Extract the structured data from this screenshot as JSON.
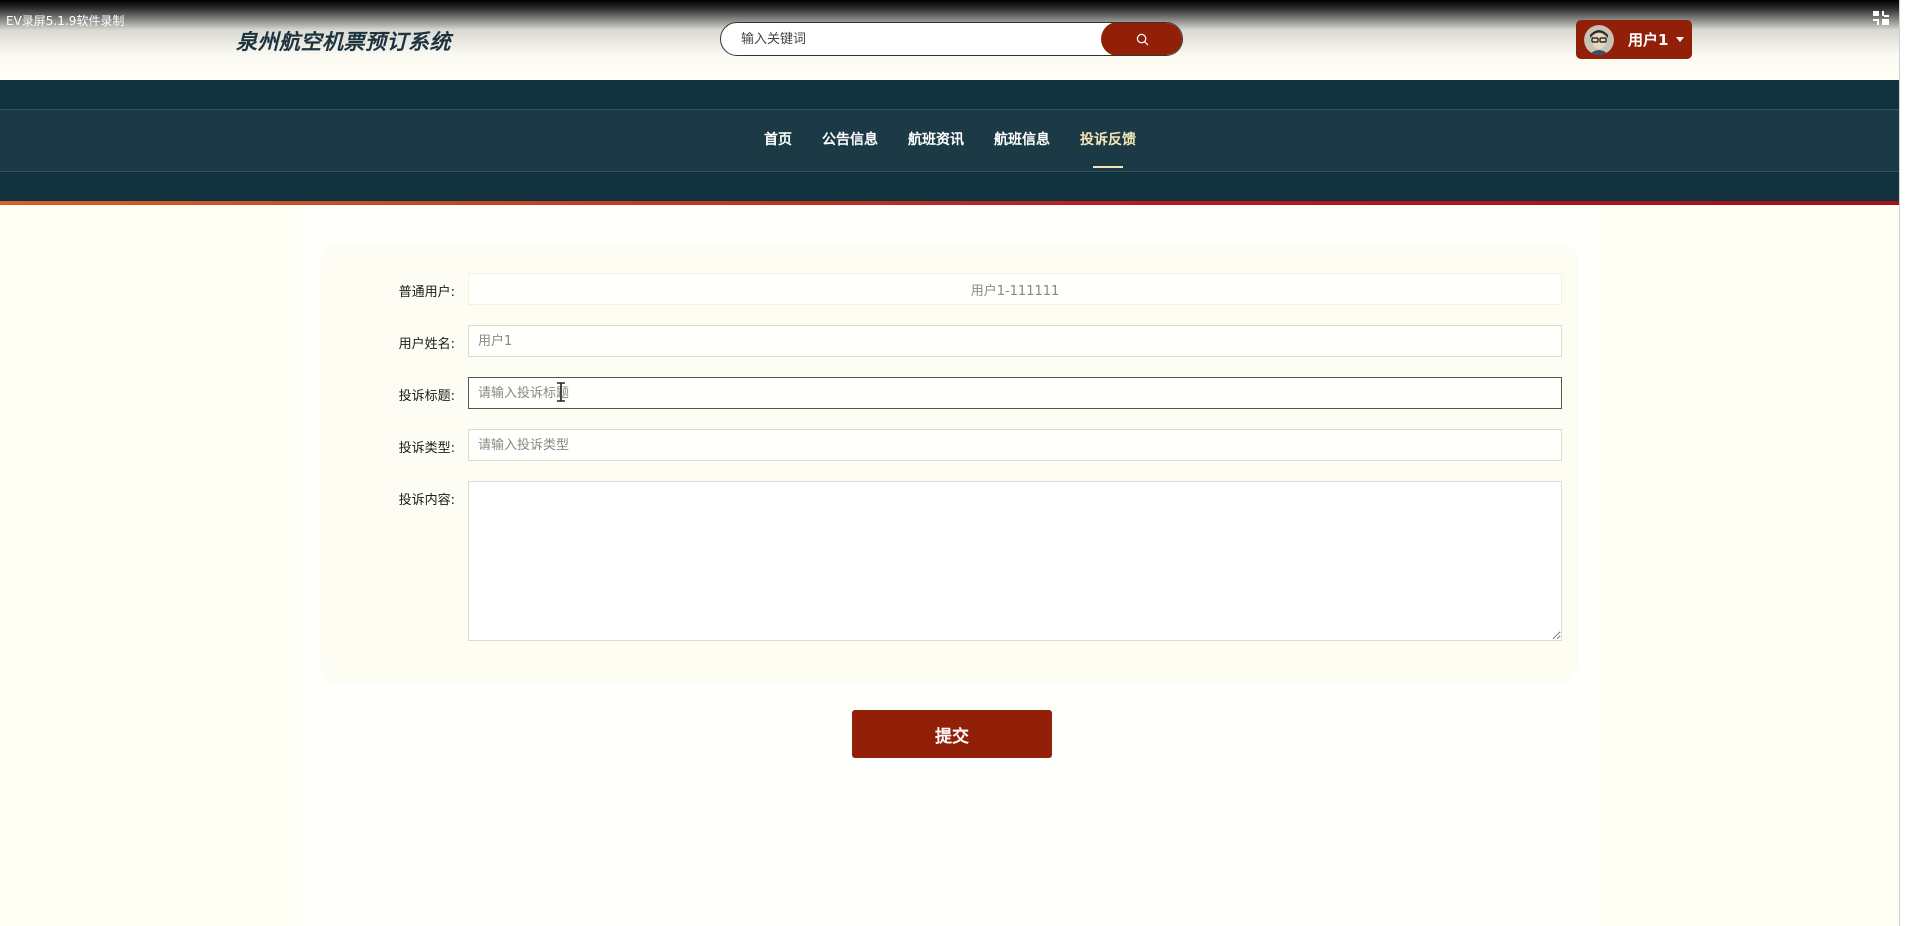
{
  "recorder": {
    "label": "EV录屏5.1.9软件录制"
  },
  "header": {
    "site_title": "泉州航空机票预订系统",
    "search_placeholder": "输入关键词",
    "user_name": "用户1"
  },
  "nav": {
    "items": [
      {
        "label": "首页"
      },
      {
        "label": "公告信息"
      },
      {
        "label": "航班资讯"
      },
      {
        "label": "航班信息"
      },
      {
        "label": "投诉反馈"
      }
    ],
    "active_index": 4
  },
  "form": {
    "fields": [
      {
        "label": "普通用户:",
        "value": "用户1-111111",
        "placeholder": ""
      },
      {
        "label": "用户姓名:",
        "value": "",
        "placeholder": "用户1"
      },
      {
        "label": "投诉标题:",
        "value": "",
        "placeholder": "请输入投诉标题"
      },
      {
        "label": "投诉类型:",
        "value": "",
        "placeholder": "请输入投诉类型"
      },
      {
        "label": "投诉内容:",
        "value": "",
        "placeholder": ""
      }
    ],
    "submit_label": "提交"
  },
  "colors": {
    "accent": "#922008",
    "nav_background": "#1b3a46",
    "page_background": "#fffff6",
    "active_nav": "#f3e6b8"
  },
  "icons": {
    "search": "search-icon",
    "fullscreen": "fullscreen-icon",
    "caret": "caret-down-icon",
    "avatar": "avatar",
    "text_cursor": "text-cursor-icon"
  }
}
